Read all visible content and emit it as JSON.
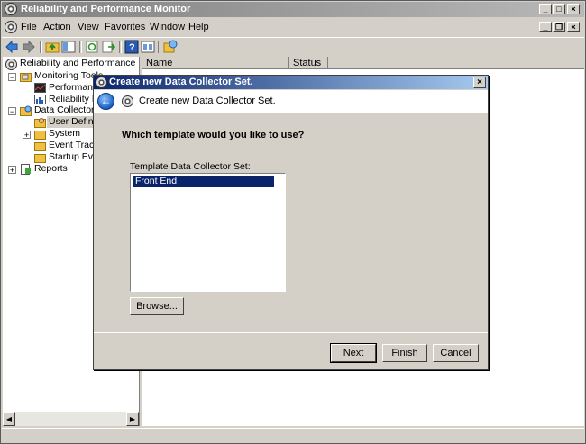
{
  "window": {
    "title": "Reliability and Performance Monitor"
  },
  "menu": [
    "File",
    "Action",
    "View",
    "Favorites",
    "Window",
    "Help"
  ],
  "tree": {
    "root": "Reliability and Performance",
    "monitoring_tools": "Monitoring Tools",
    "performance": "Performance",
    "reliability": "Reliability Mo",
    "data_collector_sets": "Data Collector Se",
    "user_defined": "User Defined",
    "system": "System",
    "event_trace": "Event Trace",
    "startup_events": "Startup Ever",
    "reports": "Reports"
  },
  "list": {
    "columns": [
      "Name",
      "Status"
    ]
  },
  "dialog": {
    "title": "Create new Data Collector Set.",
    "header": "Create new Data Collector Set.",
    "question": "Which template would you like to use?",
    "template_label": "Template Data Collector Set:",
    "templates": [
      "Front End"
    ],
    "browse_label": "Browse...",
    "next_label": "Next",
    "finish_label": "Finish",
    "cancel_label": "Cancel"
  },
  "colors": {
    "title_active": "#0a246a",
    "selection": "#0a246a",
    "chrome": "#d4d0c8"
  }
}
